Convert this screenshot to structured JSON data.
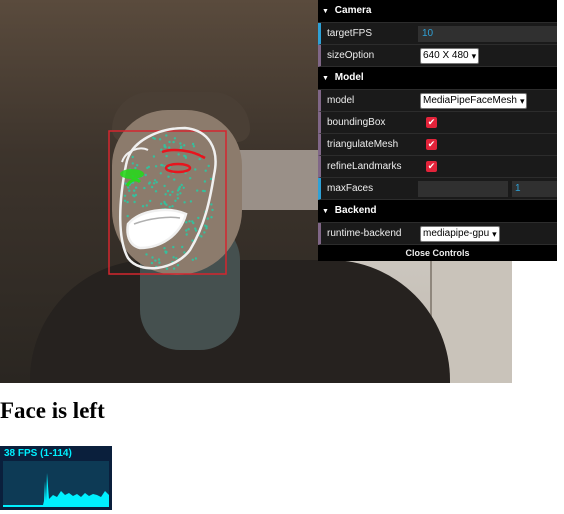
{
  "gui": {
    "camera": {
      "title": "Camera",
      "target_fps_label": "targetFPS",
      "target_fps_value": "10",
      "size_option_label": "sizeOption",
      "size_option_value": "640 X 480"
    },
    "model": {
      "title": "Model",
      "model_label": "model",
      "model_value": "MediaPipeFaceMesh",
      "bounding_box_label": "boundingBox",
      "bounding_box_checked": true,
      "triangulate_mesh_label": "triangulateMesh",
      "triangulate_mesh_checked": true,
      "refine_landmarks_label": "refineLandmarks",
      "refine_landmarks_checked": true,
      "max_faces_label": "maxFaces",
      "max_faces_value": "1"
    },
    "backend": {
      "title": "Backend",
      "runtime_label": "runtime-backend",
      "runtime_value": "mediapipe-gpu"
    },
    "close_label": "Close Controls"
  },
  "direction_text": "Face is left",
  "stats": {
    "text": "38 FPS (1-114)"
  },
  "icons": {
    "folder_open": "triangle-down-icon",
    "select_chevron": "chevron-down-icon",
    "checkbox": "checkmark-icon"
  },
  "colors": {
    "number_accent": "#2fa1d6",
    "checkbox": "#e3233a",
    "stats_text": "#00f0ff",
    "bounding_box": "#d4262e"
  }
}
